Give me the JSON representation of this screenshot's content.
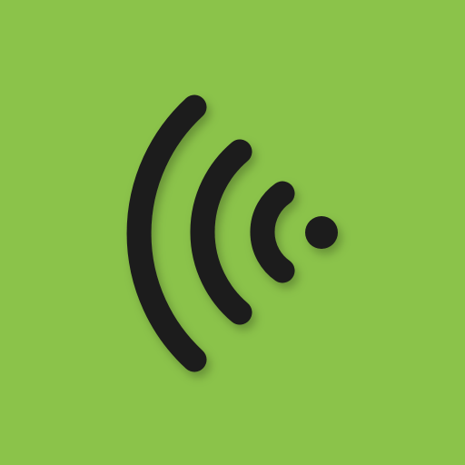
{
  "app_icon": {
    "icon": "wireless-signal-icon",
    "background_color": "#8bc34a",
    "foreground_color": "#1a1a1a"
  }
}
